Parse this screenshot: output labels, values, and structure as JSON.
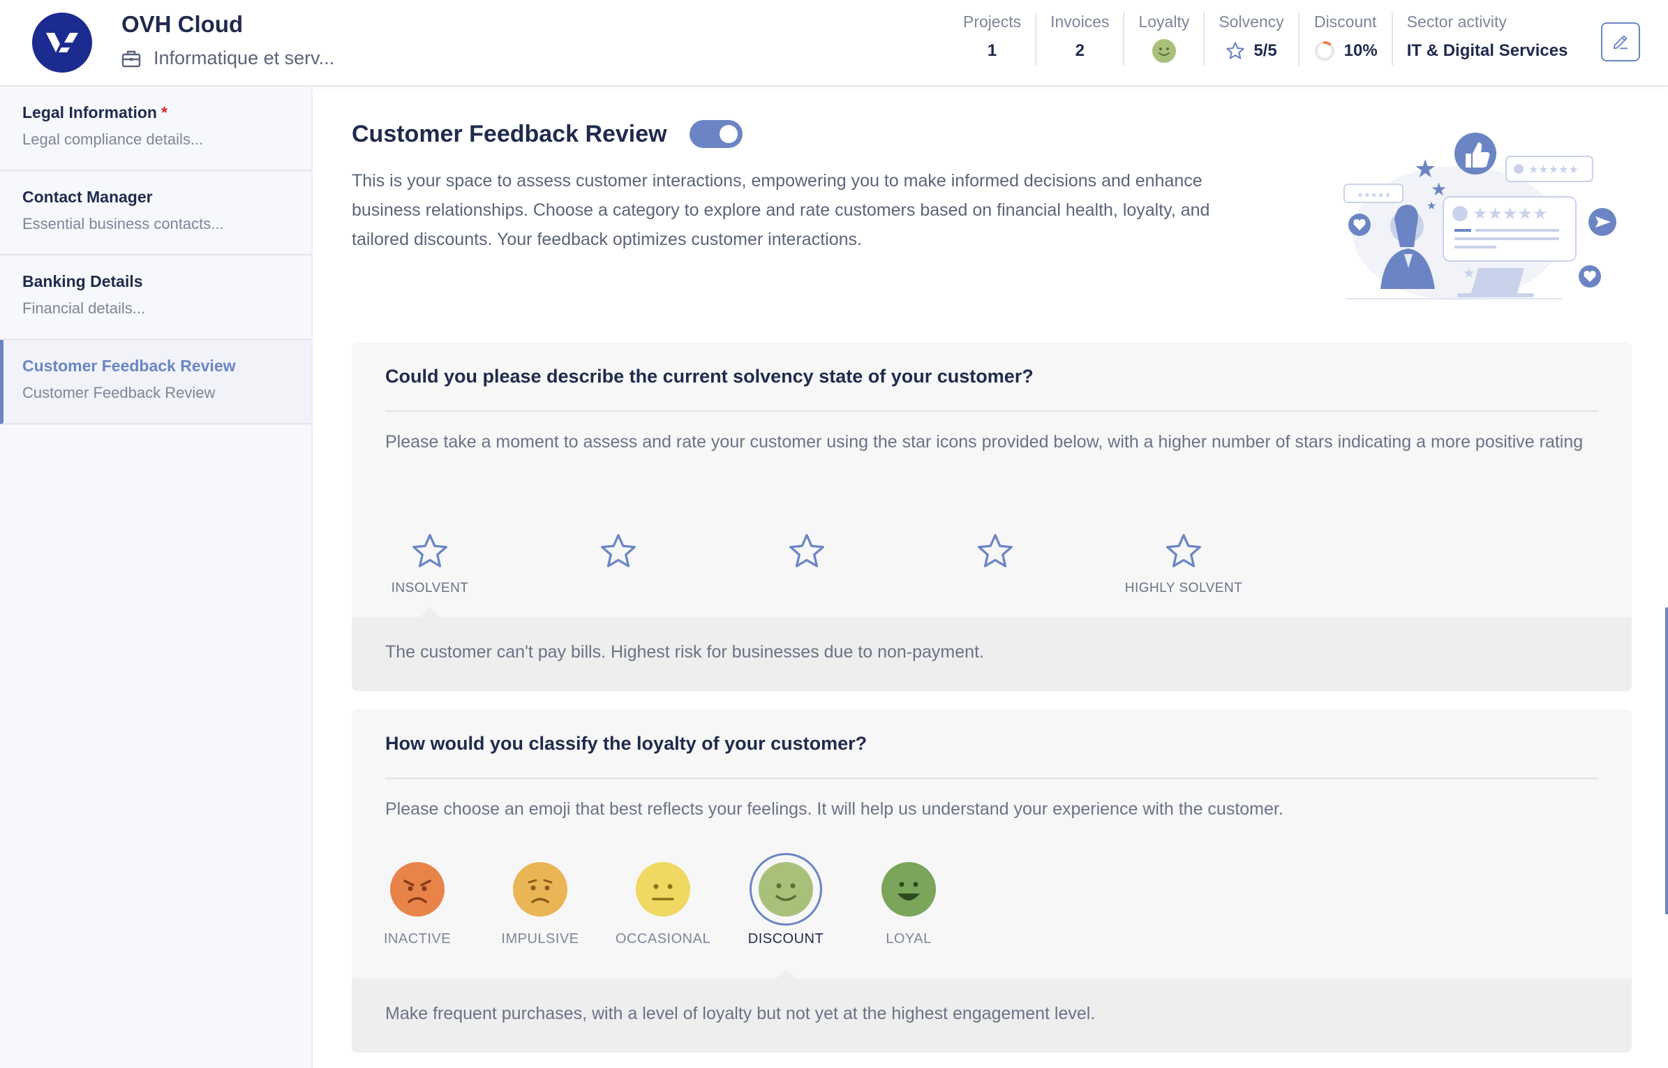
{
  "header": {
    "company_name": "OVH Cloud",
    "company_sector": "Informatique et serv...",
    "stats": [
      {
        "label": "Projects",
        "value": "1"
      },
      {
        "label": "Invoices",
        "value": "2"
      },
      {
        "label": "Loyalty",
        "icon": "smiley-icon"
      },
      {
        "label": "Solvency",
        "value": "5/5",
        "icon": "star-icon"
      },
      {
        "label": "Discount",
        "value": "10%",
        "icon": "ring-icon",
        "percent": 10
      },
      {
        "label": "Sector activity",
        "value": "IT & Digital Services"
      }
    ]
  },
  "sidebar": {
    "items": [
      {
        "title": "Legal Information",
        "required": "*",
        "subtitle": "Legal compliance details..."
      },
      {
        "title": "Contact Manager",
        "subtitle": "Essential business contacts..."
      },
      {
        "title": "Banking Details",
        "subtitle": "Financial details..."
      },
      {
        "title": "Customer Feedback Review",
        "subtitle": "Customer Feedback Review",
        "active": true
      }
    ]
  },
  "main": {
    "title": "Customer Feedback Review",
    "toggle_on": true,
    "description": "This is your space to assess customer interactions, empowering you to make informed decisions and enhance business relationships. Choose a category to explore and rate customers based on financial health, loyalty, and tailored discounts. Your feedback optimizes customer interactions.",
    "solvency": {
      "question": "Could you please describe the current solvency state of your customer?",
      "instruction": "Please take a moment to assess and rate your customer using the star icons provided below, with a higher number of stars indicating a more positive rating",
      "stars": [
        {
          "label": "INSOLVENT"
        },
        {
          "label": ""
        },
        {
          "label": ""
        },
        {
          "label": ""
        },
        {
          "label": "HIGHLY SOLVENT"
        }
      ],
      "footer": "The customer can't pay bills. Highest risk for businesses due to non-payment."
    },
    "loyalty": {
      "question": "How would you classify the loyalty of your customer?",
      "instruction": "Please choose an emoji that best reflects your feelings. It will help us understand your experience with the customer.",
      "emojis": [
        {
          "label": "INACTIVE",
          "color": "#e8834a",
          "mood": "angry"
        },
        {
          "label": "IMPULSIVE",
          "color": "#eab554",
          "mood": "sad"
        },
        {
          "label": "OCCASIONAL",
          "color": "#f1d862",
          "mood": "neutral"
        },
        {
          "label": "DISCOUNT",
          "color": "#a9c07a",
          "mood": "smile",
          "selected": true
        },
        {
          "label": "LOYAL",
          "color": "#7aa55a",
          "mood": "happy"
        }
      ],
      "footer": "Make frequent purchases, with a level of loyalty but not yet at the highest engagement level."
    }
  },
  "colors": {
    "accent": "#6b85c4",
    "brand": "#1c2b8f",
    "text_dark": "#1f2a4d",
    "required": "#d9272d"
  }
}
